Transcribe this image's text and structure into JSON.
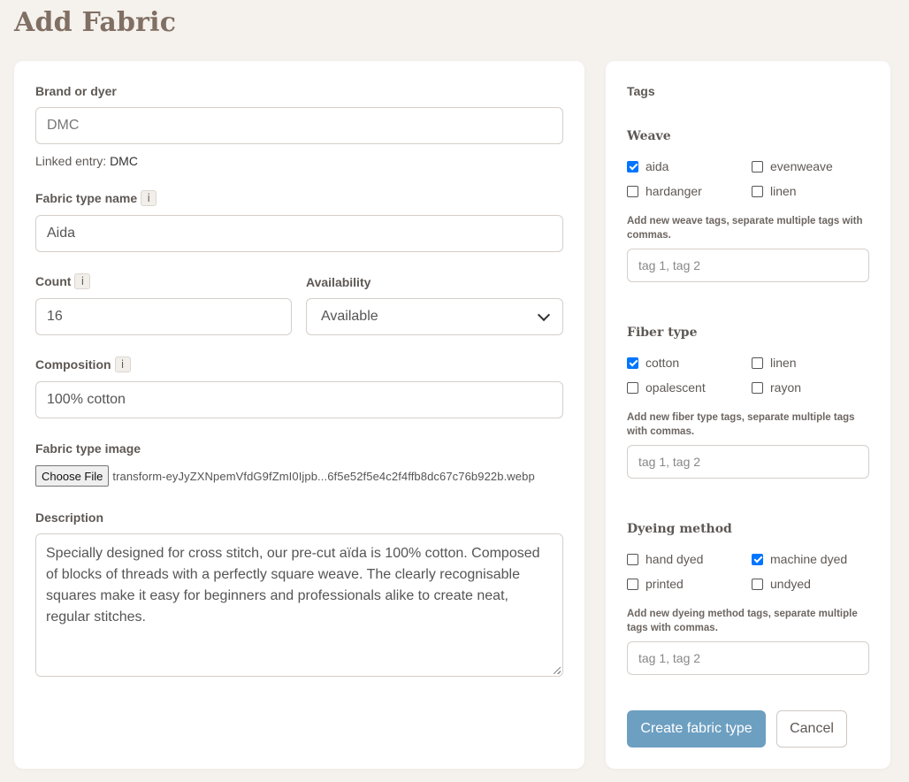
{
  "page": {
    "title": "Add Fabric"
  },
  "form": {
    "brand": {
      "label": "Brand or dyer",
      "value": "DMC",
      "linked_prefix": "Linked entry:",
      "linked_value": "DMC"
    },
    "fabric_type_name": {
      "label": "Fabric type name",
      "info": "i",
      "value": "Aida"
    },
    "count": {
      "label": "Count",
      "info": "i",
      "value": "16"
    },
    "availability": {
      "label": "Availability",
      "selected": "Available"
    },
    "composition": {
      "label": "Composition",
      "info": "i",
      "value": "100% cotton"
    },
    "image": {
      "label": "Fabric type image",
      "button_label": "Choose File",
      "file_name": "transform-eyJyZXNpemVfdG9fZmI0Ijpb...6f5e52f5e4c2f4ffb8dc67c76b922b.webp"
    },
    "description": {
      "label": "Description",
      "value": "Specially designed for cross stitch, our pre-cut aïda is 100% cotton. Composed of blocks of threads with a perfectly square weave. The clearly recognisable squares make it easy for beginners and professionals alike to create neat, regular stitches."
    }
  },
  "tags": {
    "title": "Tags",
    "groups": [
      {
        "heading": "Weave",
        "options": [
          {
            "label": "aida",
            "checked": true
          },
          {
            "label": "evenweave",
            "checked": false
          },
          {
            "label": "hardanger",
            "checked": false
          },
          {
            "label": "linen",
            "checked": false
          }
        ],
        "hint": "Add new weave tags, separate multiple tags with commas.",
        "placeholder": "tag 1, tag 2"
      },
      {
        "heading": "Fiber type",
        "options": [
          {
            "label": "cotton",
            "checked": true
          },
          {
            "label": "linen",
            "checked": false
          },
          {
            "label": "opalescent",
            "checked": false
          },
          {
            "label": "rayon",
            "checked": false
          }
        ],
        "hint": "Add new fiber type tags, separate multiple tags with commas.",
        "placeholder": "tag 1, tag 2"
      },
      {
        "heading": "Dyeing method",
        "options": [
          {
            "label": "hand dyed",
            "checked": false
          },
          {
            "label": "machine dyed",
            "checked": true
          },
          {
            "label": "printed",
            "checked": false
          },
          {
            "label": "undyed",
            "checked": false
          }
        ],
        "hint": "Add new dyeing method tags, separate multiple tags with commas.",
        "placeholder": "tag 1, tag 2"
      }
    ]
  },
  "actions": {
    "create_label": "Create fabric type",
    "cancel_label": "Cancel"
  },
  "colors": {
    "background": "#f5f1ed",
    "title": "#806f63",
    "primary_button": "#6d9fc1",
    "checkbox_checked": "#0075ff"
  }
}
